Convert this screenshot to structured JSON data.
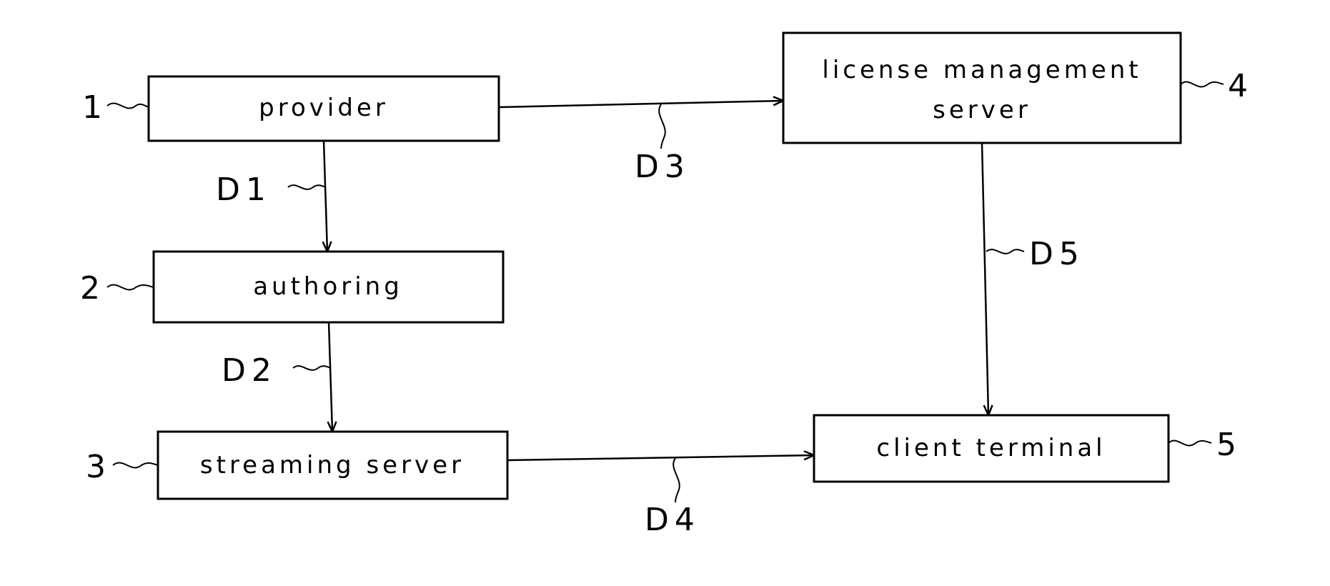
{
  "diagram": {
    "type": "block-flow",
    "nodes": [
      {
        "id": "provider",
        "ref": "1",
        "label_lines": [
          "provider"
        ]
      },
      {
        "id": "authoring",
        "ref": "2",
        "label_lines": [
          "authoring"
        ]
      },
      {
        "id": "streaming",
        "ref": "3",
        "label_lines": [
          "streaming server"
        ]
      },
      {
        "id": "license",
        "ref": "4",
        "label_lines": [
          "license management",
          "server"
        ]
      },
      {
        "id": "client",
        "ref": "5",
        "label_lines": [
          "client terminal"
        ]
      }
    ],
    "edges": [
      {
        "from": "provider",
        "to": "authoring",
        "label": "D1"
      },
      {
        "from": "authoring",
        "to": "streaming",
        "label": "D2"
      },
      {
        "from": "provider",
        "to": "license",
        "label": "D3"
      },
      {
        "from": "streaming",
        "to": "client",
        "label": "D4"
      },
      {
        "from": "license",
        "to": "client",
        "label": "D5"
      }
    ]
  },
  "labels": {
    "provider": "provider",
    "authoring": "authoring",
    "streaming": "streaming server",
    "license_line1": "license management",
    "license_line2": "server",
    "client": "client terminal",
    "ref1": "1",
    "ref2": "2",
    "ref3": "3",
    "ref4": "4",
    "ref5": "5",
    "d1": "D1",
    "d2": "D2",
    "d3": "D3",
    "d4": "D4",
    "d5": "D5"
  }
}
